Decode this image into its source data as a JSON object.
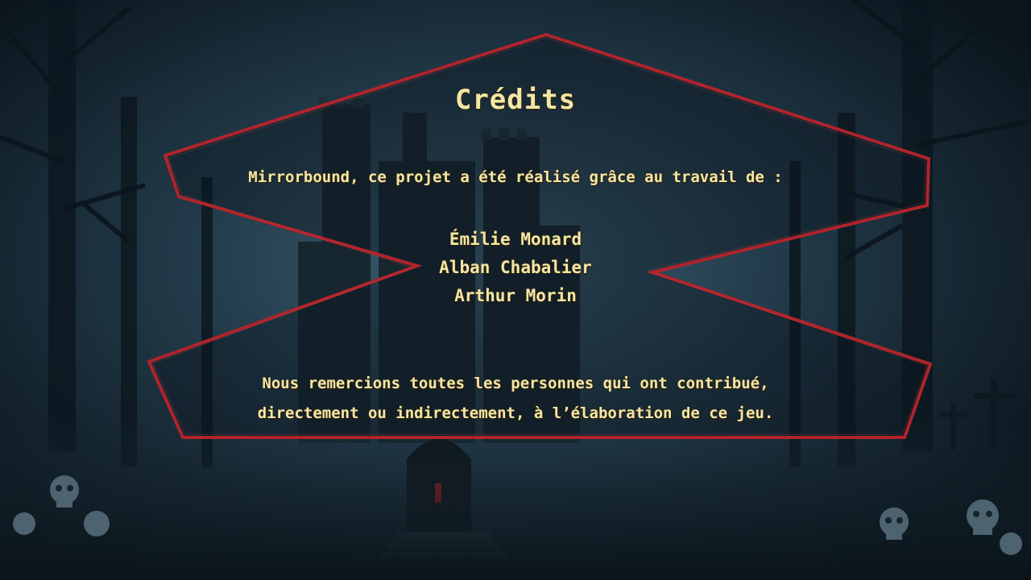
{
  "screen": "credits",
  "colors": {
    "text": "#f3e7a6",
    "frame_border": "#b0242c",
    "background": "#0f1d26"
  },
  "credits": {
    "title": "Crédits",
    "intro": "Mirrorbound, ce projet a été réalisé grâce au travail de :",
    "names": [
      "Émilie Monard",
      "Alban Chabalier",
      "Arthur Morin"
    ],
    "thanks_lines": [
      "Nous remercions toutes les personnes qui ont contribué,",
      "directement ou indirectement, à l’élaboration de ce jeu."
    ]
  }
}
